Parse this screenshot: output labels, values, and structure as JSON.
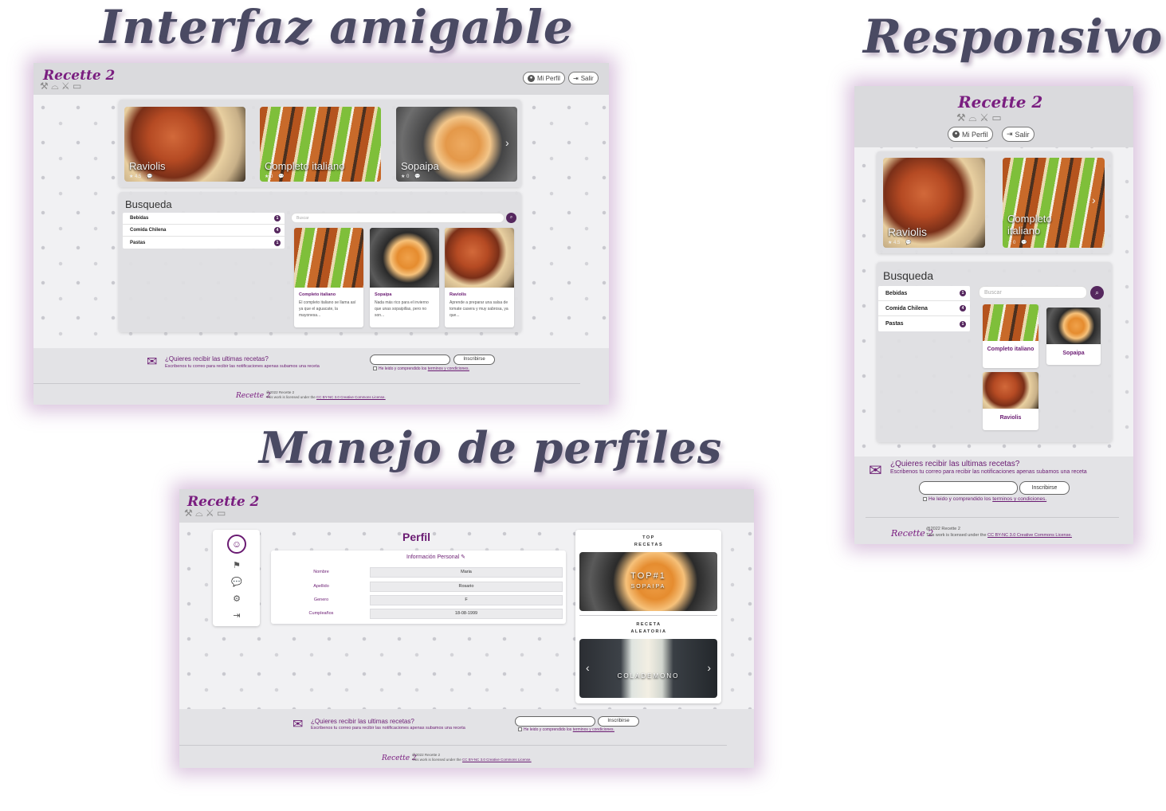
{
  "titles": {
    "friendly": "Interfaz amigable",
    "responsive": "Responsivo",
    "profiles": "Manejo de perfiles"
  },
  "app": {
    "logo": "Recette 2",
    "profile_button": "Mi Perfil",
    "logout_button": "Salir"
  },
  "carousel": [
    {
      "name": "Raviolis",
      "rating": "4.5"
    },
    {
      "name": "Completo italiano",
      "rating": "0"
    },
    {
      "name": "Sopaipa",
      "rating": "0"
    }
  ],
  "search": {
    "heading": "Busqueda",
    "placeholder": "Buscar",
    "categories": [
      {
        "name": "Bebidas",
        "count": "1"
      },
      {
        "name": "Comida Chilena",
        "count": "4"
      },
      {
        "name": "Pastas",
        "count": "1"
      }
    ]
  },
  "results": [
    {
      "title": "Completo italiano",
      "desc": "El completo italiano se llama así ya que el aguacate, la mayonesa..."
    },
    {
      "title": "Sopaipa",
      "desc": "Nada más rico para el invierno que unas sopaipillas, pero no son..."
    },
    {
      "title": "Raviolis",
      "desc": "Aprende a preparar una salsa de tomate casera y muy sabrosa, ya que..."
    }
  ],
  "mobile_results": [
    "Completo italiano",
    "Sopaipa",
    "Raviolis"
  ],
  "mobile_carousel": [
    "Raviolis",
    "Completo italiano"
  ],
  "footer": {
    "question": "¿Quieres recibir las ultimas recetas?",
    "subtext": "Escribenos tu correo para recibir las notificaciones apenas subamos una receta",
    "subscribe": "Inscribirse",
    "terms_prefix": "He leido y comprendido los ",
    "terms_link": "terminos y condiciones.",
    "copyright": "@2022 Recette 2",
    "license_prefix": "This work is licensed under the ",
    "license_link": "CC BY-NC 3.0 Creative Commons License."
  },
  "profile": {
    "title": "Perfil",
    "section": "Información Personal",
    "fields": [
      {
        "label": "Nombre",
        "value": "Maria"
      },
      {
        "label": "Apellido",
        "value": "Rosario"
      },
      {
        "label": "Genero",
        "value": "F"
      },
      {
        "label": "Cumpleaños",
        "value": "18-08-1999"
      }
    ],
    "top_label": "TOP RECETAS",
    "top_overlay": "TOP#1",
    "top_name": "SOPAIPA",
    "random_label": "RECETA ALEATORIA",
    "random_name": "COLADEMONO"
  }
}
